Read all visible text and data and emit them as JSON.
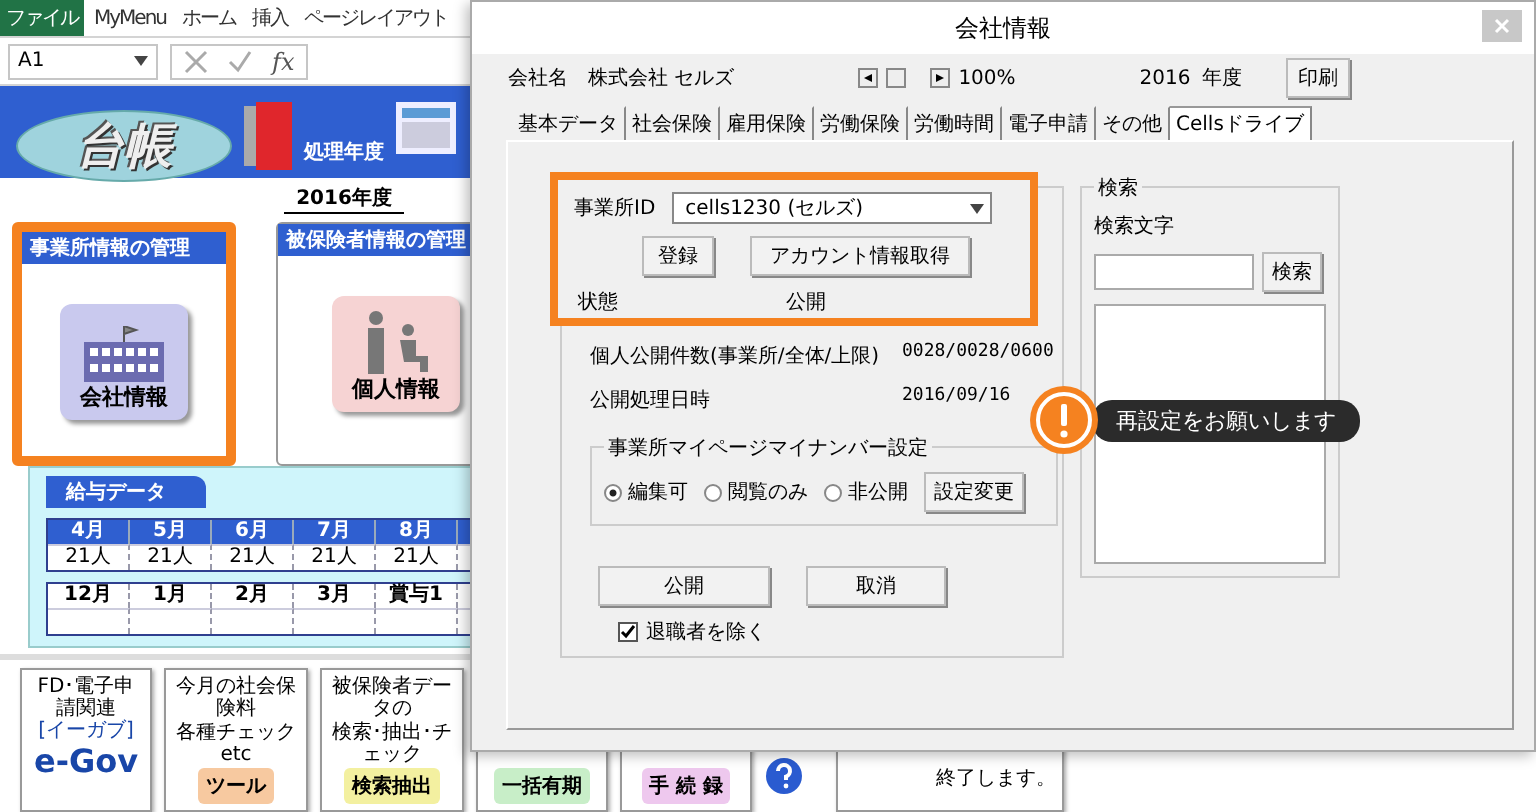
{
  "ribbon": {
    "tabs": [
      {
        "label": "ファイル",
        "selected": true
      },
      {
        "label": "MyMenu",
        "selected": false
      },
      {
        "label": "ホーム",
        "selected": false
      },
      {
        "label": "挿入",
        "selected": false
      },
      {
        "label": "ページレイアウト",
        "selected": false
      }
    ]
  },
  "formula_bar": {
    "cell": "A1",
    "function_label": "fx"
  },
  "sheet": {
    "banner": {
      "logo": "台帳",
      "year_label": "処理年度"
    },
    "year": "2016年度",
    "panels": [
      {
        "kind": "company",
        "title": "事業所情報の管理",
        "tile": "会社情報",
        "highlighted": true
      },
      {
        "kind": "person",
        "title": "被保険者情報の管理",
        "tile": "個人情報",
        "highlighted": false
      }
    ],
    "salary": {
      "title": "給与データ",
      "months": [
        {
          "month": "4月",
          "count": "21人"
        },
        {
          "month": "5月",
          "count": "21人"
        },
        {
          "month": "6月",
          "count": "21人"
        },
        {
          "month": "7月",
          "count": "21人"
        },
        {
          "month": "8月",
          "count": "21人"
        }
      ],
      "months_2": [
        "12月",
        "1月",
        "2月",
        "3月",
        "賞与1"
      ]
    },
    "tiles": [
      {
        "kind": "egov",
        "caption": [
          "FD･電子申請関連"
        ],
        "label": "e-Gov",
        "sup": "[イーガブ]"
      },
      {
        "kind": "tool",
        "caption": [
          "今月の社会保険料",
          "各種チェック etc"
        ],
        "label": "ツール"
      },
      {
        "kind": "search",
        "caption": [
          "被保険者データの",
          "検索･抽出･チェック"
        ],
        "label": "検索抽出"
      },
      {
        "kind": "bulk",
        "label": "一括有期"
      },
      {
        "kind": "procedure",
        "label": "手 続 録"
      },
      {
        "kind": "help"
      },
      {
        "kind": "exit",
        "label": "終了します。"
      }
    ]
  },
  "dialog": {
    "title": "会社情報",
    "company_label": "会社名",
    "company_name": "株式会社 セルズ",
    "zoom": "100%",
    "year": "2016",
    "year_unit": "年度",
    "print_button": "印刷",
    "tabs": [
      {
        "label": "基本データ",
        "selected": false
      },
      {
        "label": "社会保険",
        "selected": false
      },
      {
        "label": "雇用保険",
        "selected": false
      },
      {
        "label": "労働保険",
        "selected": false
      },
      {
        "label": "労働時間",
        "selected": false
      },
      {
        "label": "電子申請",
        "selected": false
      },
      {
        "label": "その他",
        "selected": false
      },
      {
        "label": "Cellsドライブ",
        "selected": true
      }
    ],
    "account": {
      "highlighted": true,
      "id_label": "事業所ID",
      "id_value": "cells1230 (セルズ)",
      "buttons": [
        "登録",
        "アカウント情報取得"
      ],
      "status_label": "状態",
      "public_label": "公開"
    },
    "counts_label": "個人公開件数(事業所/全体/上限)",
    "counts_value": "0028/0028/0600",
    "date_label": "公開処理日時",
    "date_value": "2016/09/16",
    "mypage": {
      "title": "事業所マイページマイナンバー設定",
      "options": [
        {
          "label": "編集可",
          "selected": true
        },
        {
          "label": "閲覧のみ",
          "selected": false
        },
        {
          "label": "非公開",
          "selected": false
        }
      ],
      "button": "設定変更"
    },
    "actions": [
      "公開",
      "取消"
    ],
    "exclude_retired": {
      "label": "退職者を除く",
      "checked": true
    },
    "search": {
      "title": "検索",
      "label": "検索文字",
      "button": "検索"
    },
    "callout": {
      "text": "再設定をお願いします"
    }
  }
}
